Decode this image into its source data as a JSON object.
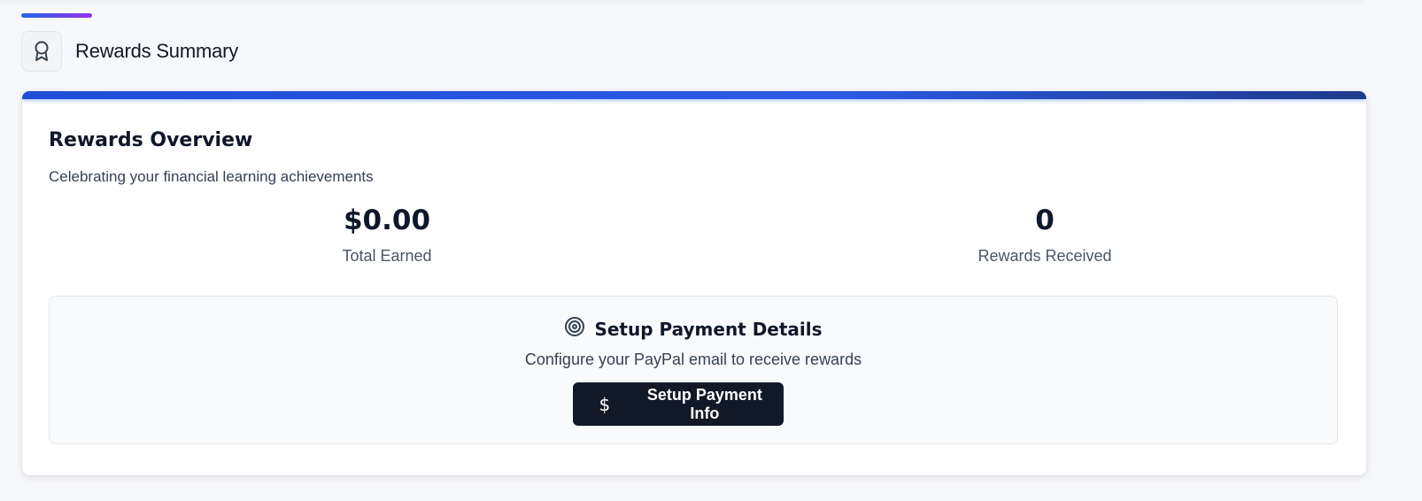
{
  "section": {
    "title": "Rewards Summary",
    "icon": "award-icon"
  },
  "overview": {
    "title": "Rewards Overview",
    "subtitle": "Celebrating your financial learning achievements"
  },
  "stats": {
    "total_earned": {
      "value": "$0.00",
      "label": "Total Earned"
    },
    "rewards_received": {
      "value": "0",
      "label": "Rewards Received"
    }
  },
  "payment": {
    "icon": "target-icon",
    "title": "Setup Payment Details",
    "subtitle": "Configure your PayPal email to receive rewards",
    "button": {
      "icon": "dollar-icon",
      "label": "Setup Payment Info"
    }
  },
  "colors": {
    "accent_blue": "#2563eb",
    "accent_purple": "#9333ea",
    "button_bg": "#111827"
  }
}
